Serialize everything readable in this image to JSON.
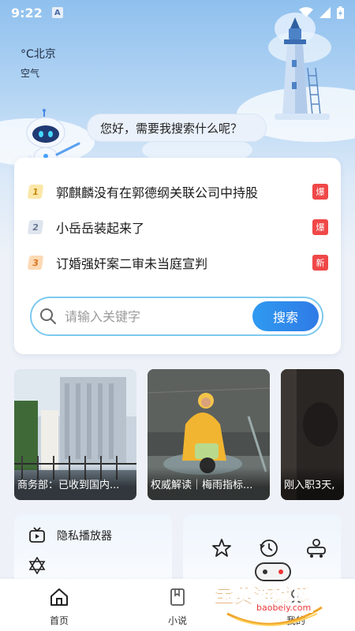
{
  "status_bar": {
    "time": "9:22",
    "badge": "A"
  },
  "weather": {
    "temp": "°C北京",
    "air": "空气"
  },
  "assistant": {
    "greeting": "您好，需要我搜索什么呢？"
  },
  "hot_list": [
    {
      "rank": "1",
      "title": "郭麒麟没有在郭德纲关联公司中持股",
      "tag": "爆"
    },
    {
      "rank": "2",
      "title": "小岳岳装起来了",
      "tag": "爆"
    },
    {
      "rank": "3",
      "title": "订婚强奸案二审未当庭宣判",
      "tag": "新"
    }
  ],
  "search": {
    "placeholder": "请输入关键字",
    "button": "搜索"
  },
  "news": [
    {
      "caption": "商务部：已收到国内..."
    },
    {
      "caption": "权威解读｜梅雨指标..."
    },
    {
      "caption": "刚入职3天,"
    }
  ],
  "tools": {
    "private_player": "隐私播放器"
  },
  "tabs": [
    {
      "label": "首页"
    },
    {
      "label": "小说"
    },
    {
      "label": "我的"
    }
  ],
  "watermark": {
    "text": "宝贝游戏网",
    "url": "baobeiy.com"
  },
  "colors": {
    "accent": "#2f86ec",
    "hot_tag": "#f04848",
    "search_border": "#7cc9ee"
  }
}
